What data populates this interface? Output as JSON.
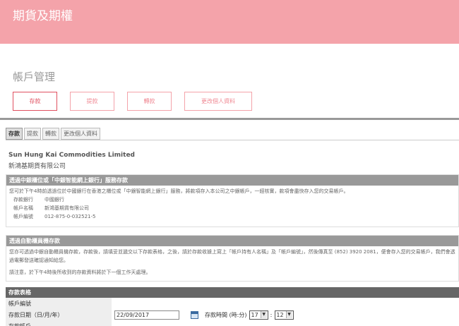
{
  "banner": {
    "title": "期貨及期權"
  },
  "section": {
    "title": "帳戶管理"
  },
  "tabs": [
    "存款",
    "提款",
    "轉款",
    "更改個人資料"
  ],
  "inner_tabs": [
    "存款",
    "提款",
    "轉款",
    "更改個人資料"
  ],
  "company": {
    "name_en": "Sun Hung Kai Commodities Limited",
    "name_zh": "新鴻基期貨有限公司"
  },
  "box1": {
    "header": "透過中銀櫃位或「中銀智能網上銀行」服務存款",
    "note": "您可於下午4時前透過位於中國銀行在香港之櫃位或「中銀智能網上銀行」服務，將款項存入本公司之中銀帳戶，一經核實，款項會盡快存入您的交易帳戶。",
    "rows": [
      {
        "k": "存款銀行",
        "v": "中國銀行"
      },
      {
        "k": "帳戶名稱",
        "v": "新鴻基期貨有限公司"
      },
      {
        "k": "帳戶編號",
        "v": "012-875-0-032521-5"
      }
    ]
  },
  "box2": {
    "header": "透過自動櫃員機存款",
    "note": "您亦可透過中銀自動櫃員機存款，存款後，請填妥並遞交以下存款表格，之後，請於存款收據上寫上「帳戶持有人名稱」及「帳戶編號」，然後傳真至 (852) 3920 2081，便會存入您的交易帳戶，我們會透過電郵發送確認通知給您。",
    "footnote": "請注意，於下午4時後所收到的存款資料將於下一個工作天處理。"
  },
  "form": {
    "header": "存款表格",
    "account_label": "帳戶編號",
    "date_label": "存款日期（日/月/年）",
    "date_value": "22/09/2017",
    "time_label": "存款時間 (時:分)",
    "hour": "17",
    "minute": "12",
    "sep": ":",
    "next_label": "存款帳戶"
  }
}
